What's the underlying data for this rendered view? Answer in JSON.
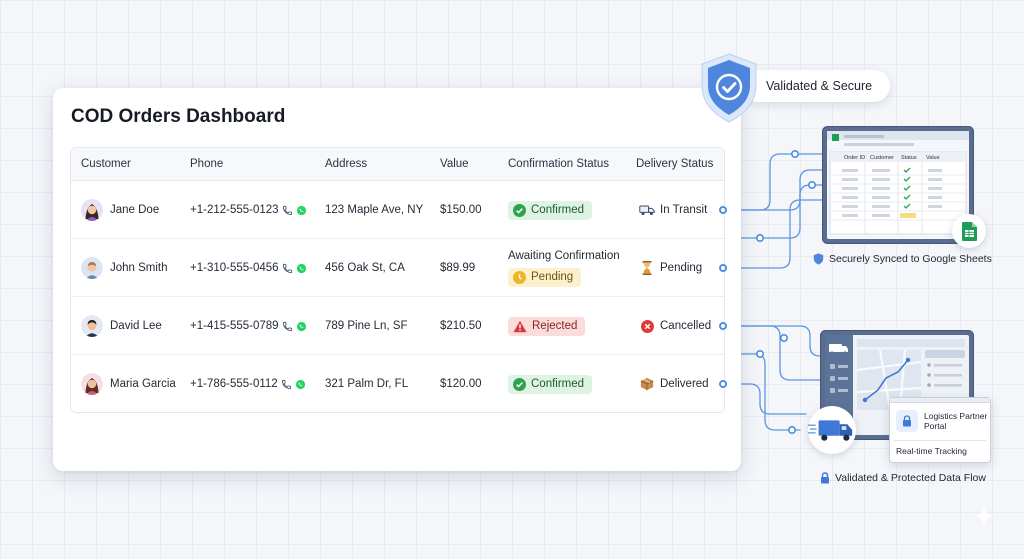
{
  "dashboard": {
    "title": "COD Orders Dashboard",
    "columns": {
      "customer": "Customer",
      "phone": "Phone",
      "address": "Address",
      "value": "Value",
      "confirmation": "Confirmation Status",
      "delivery": "Delivery Status"
    },
    "rows": [
      {
        "customer": "Jane Doe",
        "phone": "+1-212-555-0123",
        "address": "123 Maple Ave, NY",
        "value": "$150.00",
        "confirmation_note": "",
        "confirmation": "Confirmed",
        "delivery": "In Transit"
      },
      {
        "customer": "John Smith",
        "phone": "+1-310-555-0456",
        "address": "456 Oak St, CA",
        "value": "$89.99",
        "confirmation_note": "Awaiting Confirmation",
        "confirmation": "Pending",
        "delivery": "Pending"
      },
      {
        "customer": "David Lee",
        "phone": "+1-415-555-0789",
        "address": "789 Pine Ln, SF",
        "value": "$210.50",
        "confirmation_note": "",
        "confirmation": "Rejected",
        "delivery": "Cancelled"
      },
      {
        "customer": "Maria Garcia",
        "phone": "+1-786-555-0112",
        "address": "321 Palm Dr, FL",
        "value": "$120.00",
        "confirmation_note": "",
        "confirmation": "Confirmed",
        "delivery": "Delivered"
      }
    ]
  },
  "security": {
    "label": "Validated & Secure"
  },
  "sheets": {
    "caption": "Securely Synced to Google Sheets",
    "columns": [
      "Order ID",
      "Customer",
      "Status",
      "Value"
    ]
  },
  "logistics": {
    "portal_title": "Logistics Partner Portal",
    "tracking": "Real-time Tracking",
    "caption": "Validated & Protected Data Flow"
  },
  "icons": {
    "phone": "phone-icon",
    "whatsapp": "whatsapp-icon",
    "confirmed": "check-circle-icon",
    "pending": "clock-icon",
    "rejected": "warning-icon",
    "in_transit": "truck-icon",
    "pending_delivery": "hourglass-icon",
    "cancelled": "x-circle-icon",
    "delivered": "package-icon"
  },
  "colors": {
    "accent": "#4d8fe0",
    "confirmed_bg": "#dff3e3",
    "pending_bg": "#fdf0cd",
    "rejected_bg": "#fbdcdc",
    "sheets_green": "#1f9d55"
  }
}
